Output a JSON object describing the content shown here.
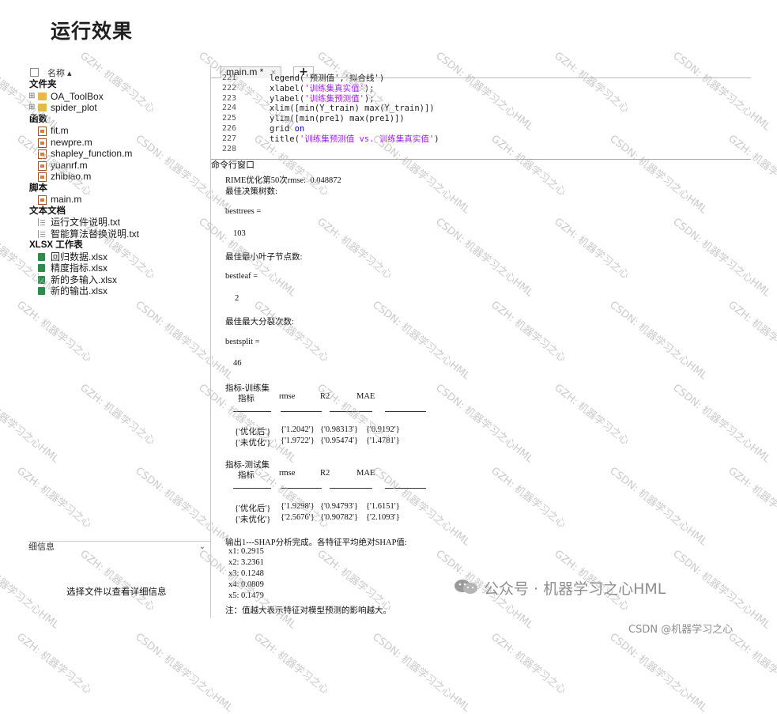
{
  "heading": "运行效果",
  "file_browser": {
    "column_name": "名称",
    "sections": [
      {
        "label": "文件夹",
        "items": [
          {
            "name": "OA_ToolBox",
            "type": "folder",
            "expand": "⊞"
          },
          {
            "name": "spider_plot",
            "type": "folder",
            "expand": "⊞"
          }
        ]
      },
      {
        "label": "函数",
        "items": [
          {
            "name": "fit.m",
            "type": "mfile"
          },
          {
            "name": "newpre.m",
            "type": "mfile"
          },
          {
            "name": "shapley_function.m",
            "type": "mfile"
          },
          {
            "name": "yuanrf.m",
            "type": "mfile"
          },
          {
            "name": "zhibiao.m",
            "type": "mfile"
          }
        ]
      },
      {
        "label": "脚本",
        "items": [
          {
            "name": "main.m",
            "type": "mfile"
          }
        ]
      },
      {
        "label": "文本文档",
        "items": [
          {
            "name": "运行文件说明.txt",
            "type": "txt"
          },
          {
            "name": "智能算法替换说明.txt",
            "type": "txt"
          }
        ]
      },
      {
        "label": "XLSX 工作表",
        "items": [
          {
            "name": "回归数据.xlsx",
            "type": "xls"
          },
          {
            "name": "精度指标.xlsx",
            "type": "xls"
          },
          {
            "name": "新的多输入.xlsx",
            "type": "xls"
          },
          {
            "name": "新的输出.xlsx",
            "type": "xls"
          }
        ]
      }
    ],
    "detail_label": "细信息",
    "detail_message": "选择文件以查看详细信息"
  },
  "editor": {
    "tab_label": "main.m",
    "tab_close": "×",
    "tab_add": "+",
    "lines": [
      {
        "no": "221",
        "html": "legend('预测值','拟合线')"
      },
      {
        "no": "222",
        "parts": [
          [
            "xlabel(",
            ""
          ],
          [
            "'训练集真实值'",
            "str"
          ],
          [
            ");",
            ""
          ]
        ]
      },
      {
        "no": "223",
        "parts": [
          [
            "ylabel(",
            ""
          ],
          [
            "'训练集预测值'",
            "str"
          ],
          [
            ");",
            ""
          ]
        ]
      },
      {
        "no": "224",
        "parts": [
          [
            "xlim([min(Y_train) max(Y_train)])",
            ""
          ]
        ]
      },
      {
        "no": "225",
        "parts": [
          [
            "ylim([min(pre1) max(pre1)])",
            ""
          ]
        ]
      },
      {
        "no": "226",
        "parts": [
          [
            "grid ",
            ""
          ],
          [
            "on",
            "kw"
          ]
        ]
      },
      {
        "no": "227",
        "parts": [
          [
            "title(",
            ""
          ],
          [
            "'训练集预测值 vs. 训练集真实值'",
            "str"
          ],
          [
            ")",
            ""
          ]
        ]
      },
      {
        "no": "228",
        "parts": [
          [
            "",
            ""
          ]
        ]
      }
    ]
  },
  "command_window": {
    "title": "命令行窗口",
    "rime_line": "RIME优化第50次rmse:  0.048872",
    "best_trees_label": "最佳决策树数:",
    "best_trees_var": "besttrees =",
    "best_trees_value": "103",
    "best_leaf_label": "最佳最小叶子节点数:",
    "best_leaf_var": "bestleaf =",
    "best_leaf_value": "2",
    "best_split_label": "最佳最大分裂次数:",
    "best_split_var": "bestsplit =",
    "best_split_value": "46",
    "train_title": "指标-训练集",
    "test_title": "指标-测试集",
    "table_headers": [
      "指标",
      "rmse",
      "R2",
      "MAE"
    ],
    "train_rows": [
      [
        "{'优化后'}",
        "{'1.2042'}",
        "{'0.98313'}",
        "{'0.9192'}"
      ],
      [
        "{'未优化'}",
        "{'1.9722'}",
        "{'0.95474'}",
        "{'1.4781'}"
      ]
    ],
    "test_rows": [
      [
        "{'优化后'}",
        "{'1.9298'}",
        "{'0.94793'}",
        "{'1.6151'}"
      ],
      [
        "{'未优化'}",
        "{'2.5676'}",
        "{'0.90782'}",
        "{'2.1093'}"
      ]
    ],
    "shap_line": "输出1---SHAP分析完成。各特征平均绝对SHAP值:",
    "shap_values": [
      "x1: 0.2915",
      "x2: 3.2361",
      "x3: 0.1248",
      "x4: 0.0809",
      "x5: 0.1479"
    ],
    "note": "注：值越大表示特征对模型预测的影响越大。"
  },
  "watermark_text": "CSDN: 机器学习之心HML",
  "watermark_text_gzh": "GZH: 机器学习之心",
  "footer": {
    "wechat": "公众号 · 机器学习之心HML",
    "csdn": "CSDN @机器学习之心"
  }
}
